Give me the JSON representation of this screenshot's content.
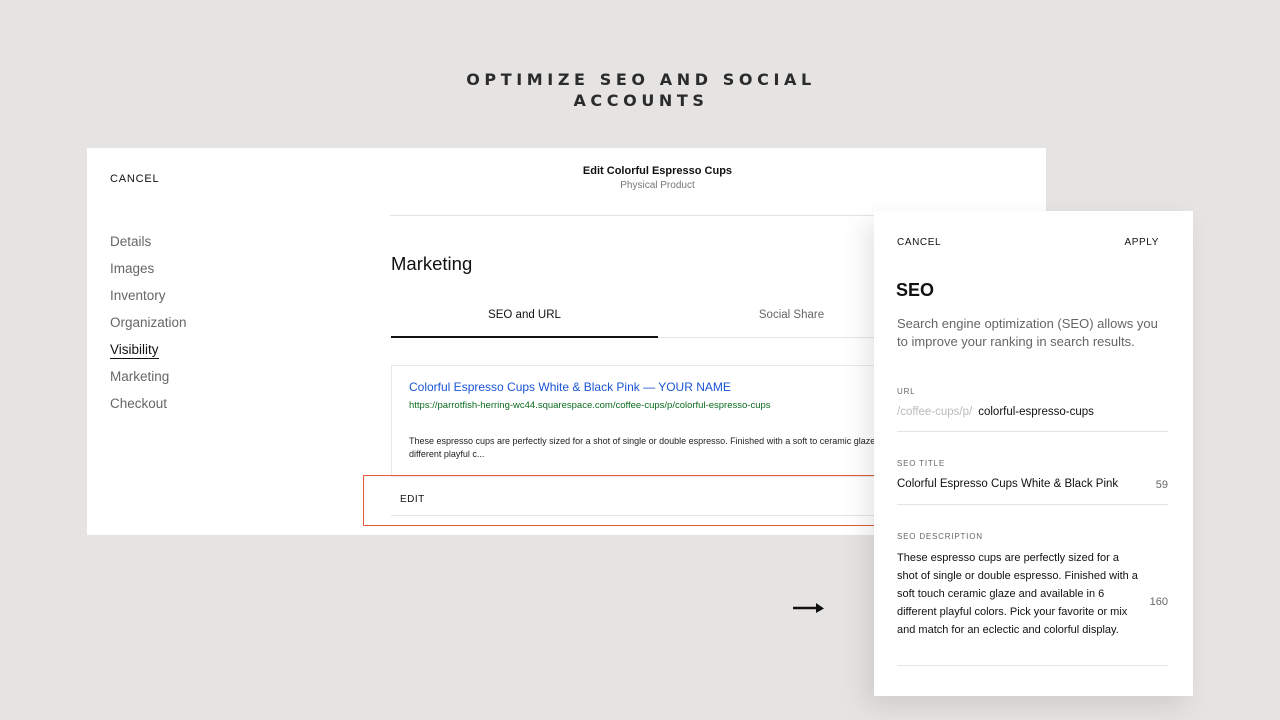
{
  "slide_title": [
    "OPTIMIZE SEO AND SOCIAL",
    "ACCOUNTS"
  ],
  "editor": {
    "cancel": "CANCEL",
    "title": "Edit Colorful Espresso Cups",
    "subtitle": "Physical Product",
    "sidebar": [
      {
        "label": "Details"
      },
      {
        "label": "Images"
      },
      {
        "label": "Inventory"
      },
      {
        "label": "Organization"
      },
      {
        "label": "Visibility",
        "active": true
      },
      {
        "label": "Marketing"
      },
      {
        "label": "Checkout"
      }
    ],
    "section_title": "Marketing",
    "tabs": [
      "SEO and URL",
      "Social Share"
    ],
    "preview": {
      "link_title": "Colorful Espresso Cups White & Black Pink — YOUR NAME",
      "url": "https://parrotfish-herring-wc44.squarespace.com/coffee-cups/p/colorful-espresso-cups",
      "description": "These espresso cups are perfectly sized for a shot of single or double espresso. Finished with a soft to ceramic glaze and available in 6 different playful c..."
    },
    "edit_label": "EDIT"
  },
  "seo_panel": {
    "cancel": "CANCEL",
    "apply": "APPLY",
    "heading": "SEO",
    "intro": "Search engine optimization (SEO) allows you to improve your ranking in search results.",
    "url_label": "URL",
    "url_prefix": "/coffee-cups/p/",
    "url_value": "colorful-espresso-cups",
    "title_label": "SEO TITLE",
    "title_value": "Colorful Espresso Cups White & Black Pink",
    "title_count": "59",
    "desc_label": "SEO DESCRIPTION",
    "desc_value": "These espresso cups are perfectly sized for a shot of single or double espresso. Finished with a soft touch ceramic glaze and available in 6 different playful colors. Pick your favorite or mix and match for an eclectic and colorful display.",
    "desc_count": "160"
  },
  "colors": {
    "accent_box": "#e05c3a",
    "link": "#1a55d4",
    "url_green": "#0b6b1f"
  },
  "icons": {
    "arrow": "right-arrow-icon"
  }
}
